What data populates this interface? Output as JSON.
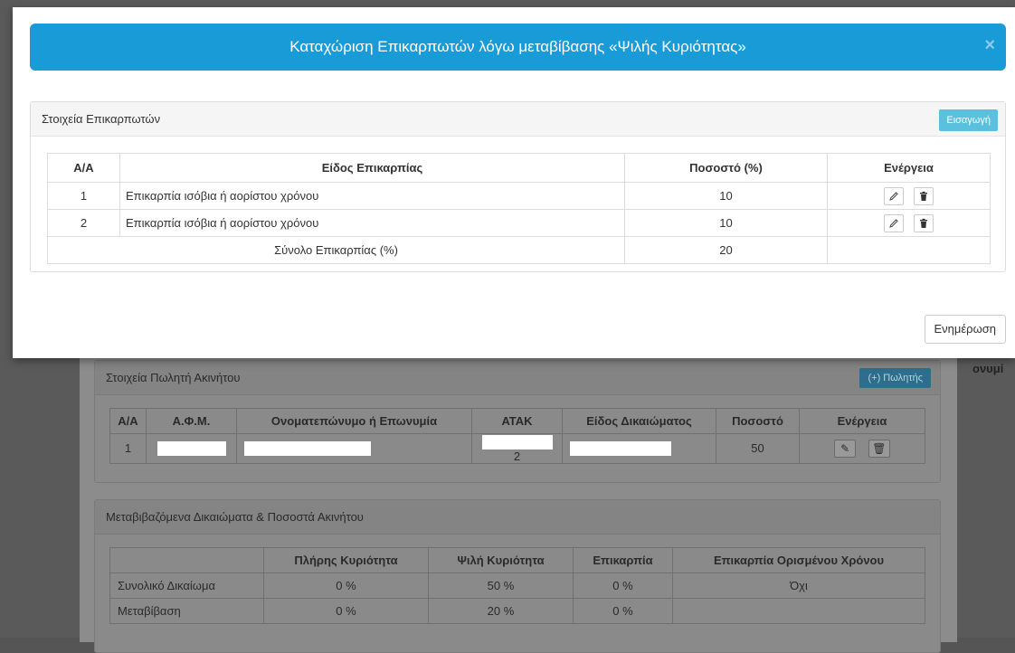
{
  "modal": {
    "title": "Καταχώριση Επικαρπωτών λόγω μεταβίβασης «Ψιλής Κυριότητας»",
    "close_symbol": "×",
    "panel_title": "Στοιχεία Επικαρπωτών",
    "insert_label": "Εισαγωγή",
    "columns": [
      "Α/Α",
      "Είδος Επικαρπίας",
      "Ποσοστό (%)",
      "Ενέργεια"
    ],
    "rows": [
      {
        "aa": "1",
        "type": "Επικαρπία ισόβια ή αορίστου χρόνου",
        "percent": "10"
      },
      {
        "aa": "2",
        "type": "Επικαρπία ισόβια ή αορίστου χρόνου",
        "percent": "10"
      }
    ],
    "total_label": "Σύνολο Επικαρπίας (%)",
    "total_value": "20",
    "update_label": "Ενημέρωση"
  },
  "background": {
    "side_text": "ονυμί",
    "seller_panel": {
      "title": "Στοιχεία Πωλητή Ακινήτου",
      "add_label": "(+) Πωλητής",
      "columns": [
        "Α/Α",
        "Α.Φ.Μ.",
        "Ονοματεπώνυμο ή Επωνυμία",
        "ΑΤΑΚ",
        "Είδος Δικαιώματος",
        "Ποσοστό",
        "Ενέργεια"
      ],
      "row": {
        "aa": "1",
        "atak_tail": "2",
        "percent": "50"
      }
    },
    "rights_panel": {
      "title": "Μεταβιβαζόμενα Δικαιώματα & Ποσοστά Ακινήτου",
      "columns": [
        "",
        "Πλήρης Κυριότητα",
        "Ψιλή Κυριότητα",
        "Επικαρπία",
        "Επικαρπία Ορισμένου Χρόνου"
      ],
      "rows": [
        {
          "label": "Συνολικό Δικαίωμα",
          "full": "0 %",
          "bare": "50 %",
          "usufruct": "0 %",
          "timed": "Όχι"
        },
        {
          "label": "Μεταβίβαση",
          "full": "0 %",
          "bare": "20 %",
          "usufruct": "0 %",
          "timed": ""
        }
      ]
    }
  },
  "icons": {
    "edit": "pencil-icon",
    "delete": "trash-icon"
  },
  "colors": {
    "header": "#199bd8",
    "insert_button": "#5bc0de"
  }
}
